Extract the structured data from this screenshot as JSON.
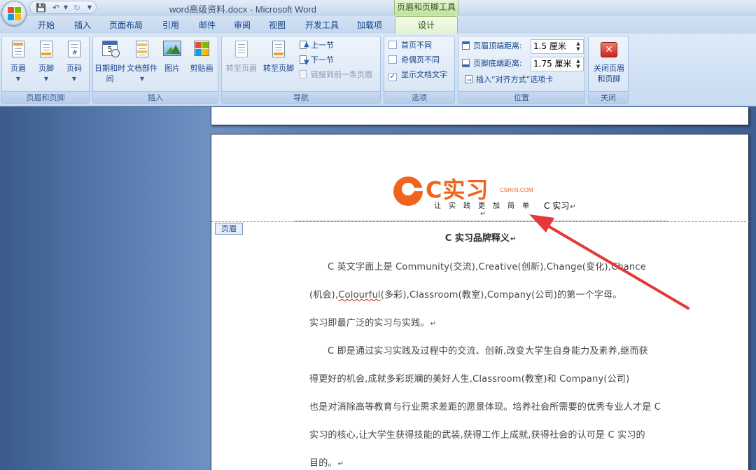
{
  "window": {
    "title": "word高级资料.docx - Microsoft Word",
    "context_tab_title": "页眉和页脚工具"
  },
  "quick_access": {
    "save_icon": "save-icon",
    "undo_icon": "undo-icon",
    "redo_icon": "redo-icon"
  },
  "tabs": [
    {
      "label": "开始"
    },
    {
      "label": "插入"
    },
    {
      "label": "页面布局"
    },
    {
      "label": "引用"
    },
    {
      "label": "邮件"
    },
    {
      "label": "审阅"
    },
    {
      "label": "视图"
    },
    {
      "label": "开发工具"
    },
    {
      "label": "加载项"
    },
    {
      "label": "设计",
      "active": true
    }
  ],
  "ribbon": {
    "header_footer_group": {
      "label": "页眉和页脚",
      "header": "页眉",
      "footer": "页脚",
      "page_number": "页码"
    },
    "insert_group": {
      "label": "插入",
      "date_time": "日期和时间",
      "doc_parts": "文档部件",
      "picture": "图片",
      "clip_art": "剪贴画"
    },
    "navigation_group": {
      "label": "导航",
      "goto_header": "转至页眉",
      "goto_footer": "转至页脚",
      "prev_section": "上一节",
      "next_section": "下一节",
      "link_previous": "链接到前一条页眉"
    },
    "options_group": {
      "label": "选项",
      "different_first": "首页不同",
      "different_odd_even": "奇偶页不同",
      "show_doc_text": "显示文档文字",
      "show_doc_text_checked": true
    },
    "position_group": {
      "label": "位置",
      "header_top_label": "页眉顶端距离:",
      "header_top_value": "1.5 厘米",
      "footer_bottom_label": "页脚底端距离:",
      "footer_bottom_value": "1.75 厘米",
      "insert_align_tab": "插入“对齐方式”选项卡"
    },
    "close_group": {
      "label": "关闭",
      "close_button": "关闭页眉和页脚"
    }
  },
  "document": {
    "header_tag": "页眉",
    "logo_text": "C实习",
    "logo_domain": "CSHIXI.COM",
    "logo_slogan": "让实践更加简单",
    "header_text": "C 实习",
    "paragraph_mark": "↵",
    "title": "C 实习品牌释义",
    "lines": [
      "C 英文字面上是 Community(交流),Creative(创新),Change(变化),Chance",
      "(机会),",
      "Colourful",
      "(多彩),Classroom(教室),Company(公司)的第一个字母。",
      "实习即最广泛的实习与实践。",
      "C 即是通过实习实践及过程中的交流、创新,改变大学生自身能力及素养,继而获",
      "得更好的机会,成就多彩斑斓的美好人生,Classroom(教室)和 Company(公司)",
      "也是对消除高等教育与行业需求差距的愿景体现。培养社会所需要的优秀专业人才是 C",
      "实习的核心,让大学生获得技能的武装,获得工作上成就,获得社会的认可是 C 实习的",
      "目的。"
    ]
  },
  "colors": {
    "accent_orange": "#f0641e",
    "annotation_arrow": "#e53935",
    "context_tab_green": "#bfe19c"
  }
}
